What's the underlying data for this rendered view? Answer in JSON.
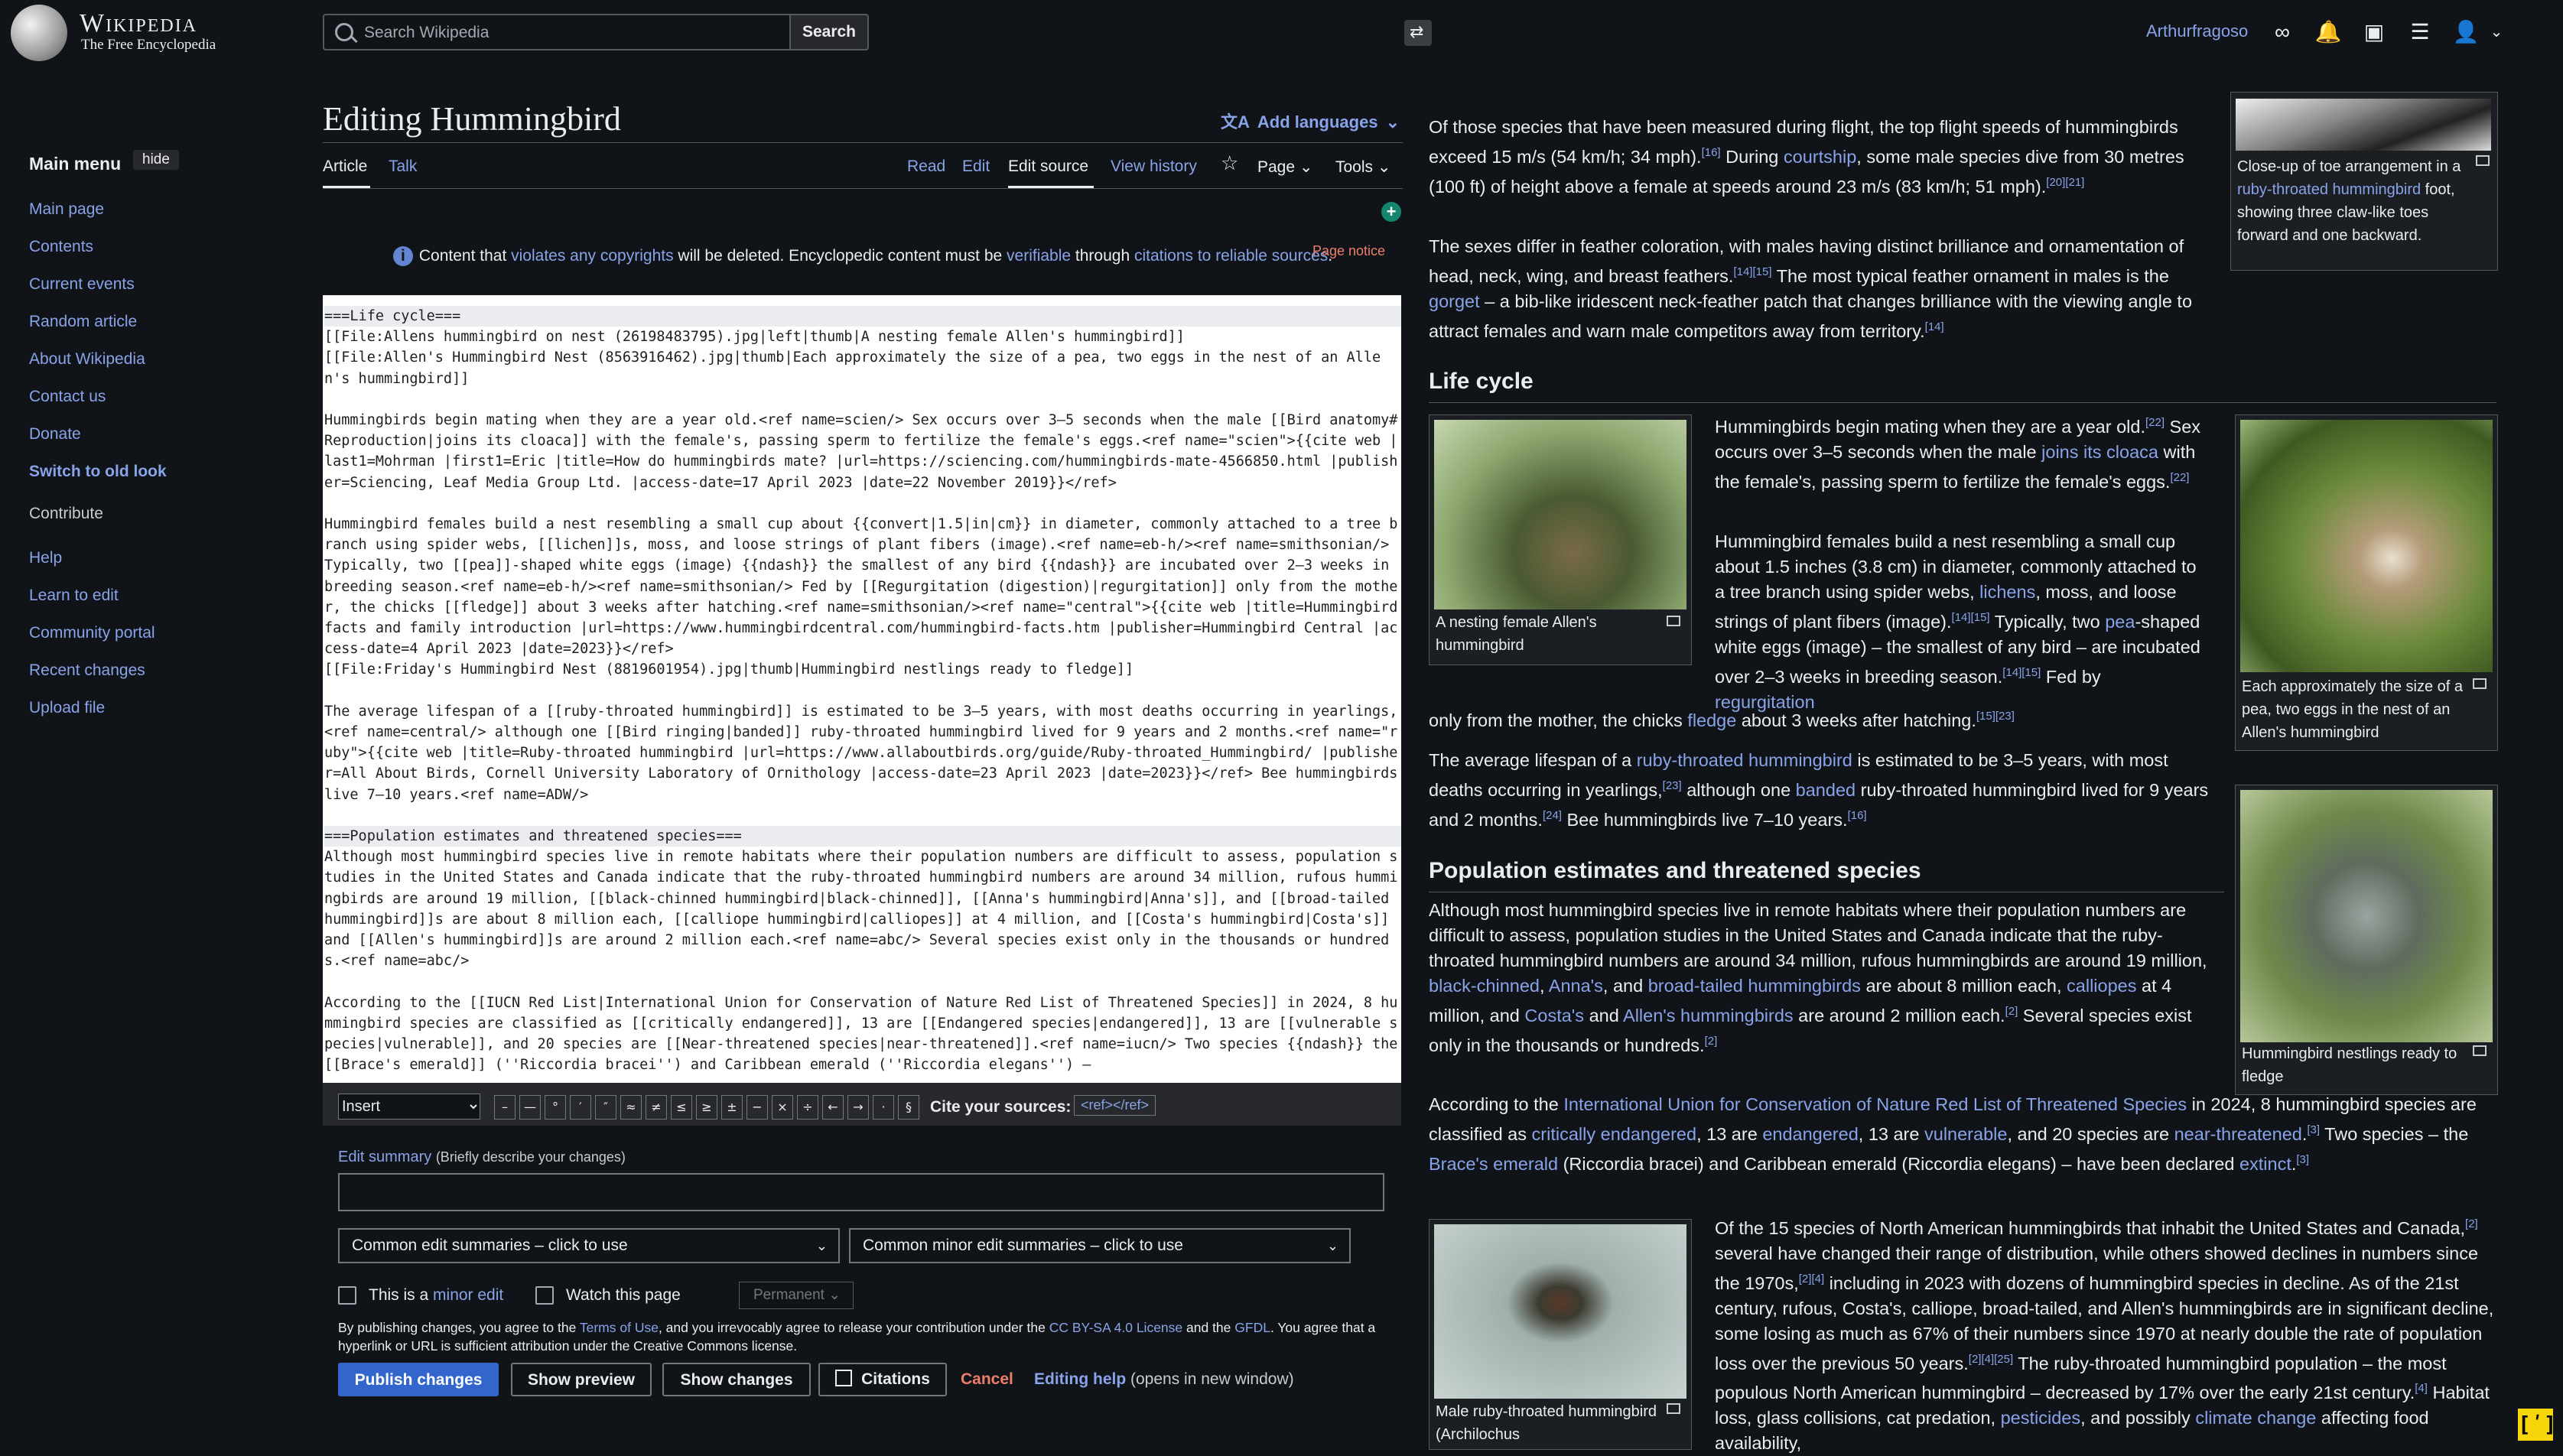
{
  "logo": {
    "wordmark": "Wikipedia",
    "tagline": "The Free Encyclopedia"
  },
  "search": {
    "placeholder": "Search Wikipedia",
    "button": "Search"
  },
  "user": {
    "name": "Arthurfragoso"
  },
  "sidebar": {
    "title": "Main menu",
    "hide_label": "hide",
    "nav": [
      "Main page",
      "Contents",
      "Current events",
      "Random article",
      "About Wikipedia",
      "Contact us",
      "Donate",
      "Switch to old look"
    ],
    "contribute_title": "Contribute",
    "contribute": [
      "Help",
      "Learn to edit",
      "Community portal",
      "Recent changes",
      "Upload file"
    ]
  },
  "page": {
    "title": "Editing Hummingbird",
    "add_languages": "Add languages",
    "tabs_left": [
      "Article",
      "Talk"
    ],
    "tabs_right": [
      "Read",
      "Edit",
      "Edit source",
      "View history"
    ],
    "page_menu": "Page",
    "tools_menu": "Tools",
    "page_notice": "Page notice",
    "notice": {
      "a": "Content that ",
      "b": "violates any copyrights",
      "c": " will be deleted. Encyclopedic content must be ",
      "d": "verifiable",
      "e": " through ",
      "f": "citations to reliable sources",
      "g": "."
    }
  },
  "editor": {
    "lines": [
      "===Life cycle===",
      "[[File:Allens hummingbird on nest (26198483795).jpg|left|thumb|A nesting female Allen's hummingbird]]",
      "[[File:Allen's Hummingbird Nest (8563916462).jpg|thumb|Each approximately the size of a pea, two eggs in the nest of an Allen's hummingbird]]",
      "",
      "Hummingbirds begin mating when they are a year old.<ref name=scien/> Sex occurs over 3–5 seconds when the male [[Bird anatomy#Reproduction|joins its cloaca]] with the female's, passing sperm to fertilize the female's eggs.<ref name=\"scien\">{{cite web |last1=Mohrman |first1=Eric |title=How do hummingbirds mate? |url=https://sciencing.com/hummingbirds-mate-4566850.html |publisher=Sciencing, Leaf Media Group Ltd. |access-date=17 April 2023 |date=22 November 2019}}</ref>",
      "",
      "Hummingbird females build a nest resembling a small cup about {{convert|1.5|in|cm}} in diameter, commonly attached to a tree branch using spider webs, [[lichen]]s, moss, and loose strings of plant fibers (image).<ref name=eb-h/><ref name=smithsonian/> Typically, two [[pea]]-shaped white eggs (image) {{ndash}} the smallest of any bird {{ndash}} are incubated over 2–3 weeks in breeding season.<ref name=eb-h/><ref name=smithsonian/> Fed by [[Regurgitation (digestion)|regurgitation]] only from the mother, the chicks [[fledge]] about 3 weeks after hatching.<ref name=smithsonian/><ref name=\"central\">{{cite web |title=Hummingbird facts and family introduction |url=https://www.hummingbirdcentral.com/hummingbird-facts.htm |publisher=Hummingbird Central |access-date=4 April 2023 |date=2023}}</ref>",
      "[[File:Friday's Hummingbird Nest (8819601954).jpg|thumb|Hummingbird nestlings ready to fledge]]",
      "",
      "The average lifespan of a [[ruby-throated hummingbird]] is estimated to be 3–5 years, with most deaths occurring in yearlings,<ref name=central/> although one [[Bird ringing|banded]] ruby-throated hummingbird lived for 9 years and 2 months.<ref name=\"ruby\">{{cite web |title=Ruby-throated hummingbird |url=https://www.allaboutbirds.org/guide/Ruby-throated_Hummingbird/ |publisher=All About Birds, Cornell University Laboratory of Ornithology |access-date=23 April 2023 |date=2023}}</ref> Bee hummingbirds live 7–10 years.<ref name=ADW/>",
      "",
      "===Population estimates and threatened species===",
      "Although most hummingbird species live in remote habitats where their population numbers are difficult to assess, population studies in the United States and Canada indicate that the ruby-throated hummingbird numbers are around 34 million, rufous hummingbirds are around 19 million, [[black-chinned hummingbird|black-chinned]], [[Anna's hummingbird|Anna's]], and [[broad-tailed hummingbird]]s are about 8 million each, [[calliope hummingbird|calliopes]] at 4 million, and [[Costa's hummingbird|Costa's]] and [[Allen's hummingbird]]s are around 2 million each.<ref name=abc/> Several species exist only in the thousands or hundreds.<ref name=abc/>",
      "",
      "According to the [[IUCN Red List|International Union for Conservation of Nature Red List of Threatened Species]] in 2024, 8 hummingbird species are classified as [[critically endangered]], 13 are [[Endangered species|endangered]], 13 are [[vulnerable species|vulnerable]], and 20 species are [[Near-threatened species|near-threatened]].<ref name=iucn/> Two species {{ndash}} the [[Brace's emerald]] (''Riccordia bracei'') and Caribbean emerald (''Riccordia elegans'') –"
    ]
  },
  "toolbar": {
    "insert": "Insert",
    "symbols": [
      "–",
      "—",
      "°",
      "′",
      "″",
      "≈",
      "≠",
      "≤",
      "≥",
      "±",
      "−",
      "×",
      "÷",
      "←",
      "→",
      "·",
      "§"
    ],
    "cite_label": "Cite your sources:",
    "cite_tag": "<ref></ref>"
  },
  "summary": {
    "label": "Edit summary",
    "hint": "(Briefly describe your changes)",
    "common": "Common edit summaries – click to use",
    "common_minor": "Common minor edit summaries – click to use"
  },
  "options": {
    "minor_a": "This is a ",
    "minor_b": "minor edit",
    "watch": "Watch this page",
    "permanent": "Permanent"
  },
  "legal": {
    "p1": "By publishing changes, you agree to the ",
    "terms": "Terms of Use",
    "p2": ", and you irrevocably agree to release your contribution under the ",
    "cc": "CC BY-SA 4.0 License",
    "p3": " and the ",
    "gfdl": "GFDL",
    "p4": ". You agree that a hyperlink or URL is sufficient attribution under the Creative Commons license."
  },
  "buttons": {
    "publish": "Publish changes",
    "preview": "Show preview",
    "changes": "Show changes",
    "citations": "Citations",
    "cancel": "Cancel",
    "help": "Editing help",
    "help_note": " (opens in new window)"
  },
  "preview": {
    "intro_p1": "Of those species that have been measured during flight, the top flight speeds of hummingbirds exceed 15 m/s (54 km/h; 34 mph).",
    "intro_p1_ref": "[16]",
    "intro_p1b": " During ",
    "intro_courtship": "courtship",
    "intro_p1c": ", some male species dive from 30 metres (100 ft) of height above a female at speeds around 23 m/s (83 km/h; 51 mph).",
    "intro_p1c_ref": "[20][21]",
    "intro_p2": "The sexes differ in feather coloration, with males having distinct brilliance and ornamentation of head, neck, wing, and breast feathers.",
    "intro_p2_ref": "[14][15]",
    "intro_p2b": " The most typical feather ornament in males is the ",
    "gorget": "gorget",
    "intro_p2c": " – a bib-like iridescent neck-feather patch that changes brilliance with the viewing angle to attract females and warn male competitors away from territory.",
    "intro_p2c_ref": "[14]",
    "toe_caption_a": "Close-up of toe arrangement in a ",
    "toe_caption_link": "ruby-throated hummingbird",
    "toe_caption_b": " foot, showing three claw-like toes forward and one backward.",
    "h_life": "Life cycle",
    "nest_caption": "A nesting female Allen's hummingbird",
    "eggs_caption": "Each approximately the size of a pea, two eggs in the nest of an Allen's hummingbird",
    "life_p1a": "Hummingbirds begin mating when they are a year old.",
    "life_p1a_ref": "[22]",
    "life_p1b": " Sex occurs over 3–5 seconds when the male ",
    "life_cloaca": "joins its cloaca",
    "life_p1c": " with the female's, passing sperm to fertilize the female's eggs.",
    "life_p1c_ref": "[22]",
    "life_p2a": "Hummingbird females build a nest resembling a small cup about 1.5 inches (3.8 cm) in diameter, commonly attached to a tree branch using spider webs, ",
    "lichens": "lichens",
    "life_p2b": ", moss, and loose strings of plant fibers (image).",
    "life_p2b_ref": "[14][15]",
    "life_p2c": " Typically, two ",
    "pea": "pea",
    "life_p2d": "-shaped white eggs (image) – the smallest of any bird – are incubated over 2–3 weeks in breeding season.",
    "life_p2d_ref": "[14][15]",
    "life_p2e": " Fed by ",
    "regurgitation": "regurgitation",
    "life_p2f": " only from the mother, the chicks ",
    "fledge": "fledge",
    "life_p2g": " about 3 weeks after hatching.",
    "life_p2g_ref": "[15][23]",
    "life_p3a": "The average lifespan of a ",
    "ruby": "ruby-throated hummingbird",
    "life_p3b": " is estimated to be 3–5 years, with most deaths occurring in yearlings,",
    "life_p3b_ref": "[23]",
    "life_p3c": " although one ",
    "banded": "banded",
    "life_p3d": " ruby-throated hummingbird lived for 9 years and 2 months.",
    "life_p3d_ref": "[24]",
    "life_p3e": " Bee hummingbirds live 7–10 years.",
    "life_p3e_ref": "[16]",
    "nestlings_caption": "Hummingbird nestlings ready to fledge",
    "h_pop": "Population estimates and threatened species",
    "pop_p1a": "Although most hummingbird species live in remote habitats where their population numbers are difficult to assess, population studies in the United States and Canada indicate that the ruby-throated hummingbird numbers are around 34 million, rufous hummingbirds are around 19 million, ",
    "blackchinned": "black-chinned",
    "pop_p1b": ", ",
    "annas": "Anna's",
    "pop_p1c": ", and ",
    "broadtailed": "broad-tailed hummingbirds",
    "pop_p1d": " are about 8 million each, ",
    "calliopes": "calliopes",
    "pop_p1e": " at 4 million, and ",
    "costas": "Costa's",
    "pop_p1f": " and ",
    "allens": "Allen's hummingbirds",
    "pop_p1g": " are around 2 million each.",
    "pop_p1g_ref": "[2]",
    "pop_p1h": " Several species exist only in the thousands or hundreds.",
    "pop_p1h_ref": "[2]",
    "pop_p2a": "According to the ",
    "iucn": "International Union for Conservation of Nature Red List of Threatened Species",
    "pop_p2b": " in 2024, 8 hummingbird species are classified as ",
    "critical": "critically endangered",
    "pop_p2c": ", 13 are ",
    "endangered": "endangered",
    "pop_p2d": ", 13 are ",
    "vulnerable": "vulnerable",
    "pop_p2e": ", and 20 species are ",
    "nearthreatened": "near-threatened",
    "pop_p2e_ref": "[3]",
    "pop_p2f": " Two species – the ",
    "braces": "Brace's emerald",
    "pop_p2g": " (Riccordia bracei) and Caribbean emerald (Riccordia elegans) – have been declared ",
    "extinct": "extinct",
    "pop_p2g_ref": "[3]",
    "pop_p3a": "Of the 15 species of North American hummingbirds that inhabit the United States and Canada,",
    "pop_p3a_ref": "[2]",
    "pop_p3b": " several have changed their range of distribution, while others showed declines in numbers since the 1970s,",
    "pop_p3b_ref": "[2][4]",
    "pop_p3c": " including in 2023 with dozens of hummingbird species in decline. As of the 21st century, rufous, Costa's, calliope, broad-tailed, and Allen's hummingbirds are in significant decline, some losing as much as 67% of their numbers since 1970 at nearly double the rate of population loss over the previous 50 years.",
    "pop_p3c_ref": "[2][4][25]",
    "pop_p3d": " The ruby-throated hummingbird population – the most populous North American hummingbird – decreased by 17% over the early 21st century.",
    "pop_p3d_ref": "[4]",
    "pop_p3e": " Habitat loss, glass collisions, cat predation, ",
    "pesticides": "pesticides",
    "pop_p3f": ", and possibly ",
    "climate": "climate change",
    "pop_p3g": " affecting food availability,",
    "ruby_caption": "Male ruby-throated hummingbird (Archilochus"
  },
  "corner_badge": "[ʹ]",
  "colors": {
    "background": "#101418",
    "link": "#88a3e8",
    "publish": "#3366cc",
    "cancel": "#ec7e6a"
  }
}
